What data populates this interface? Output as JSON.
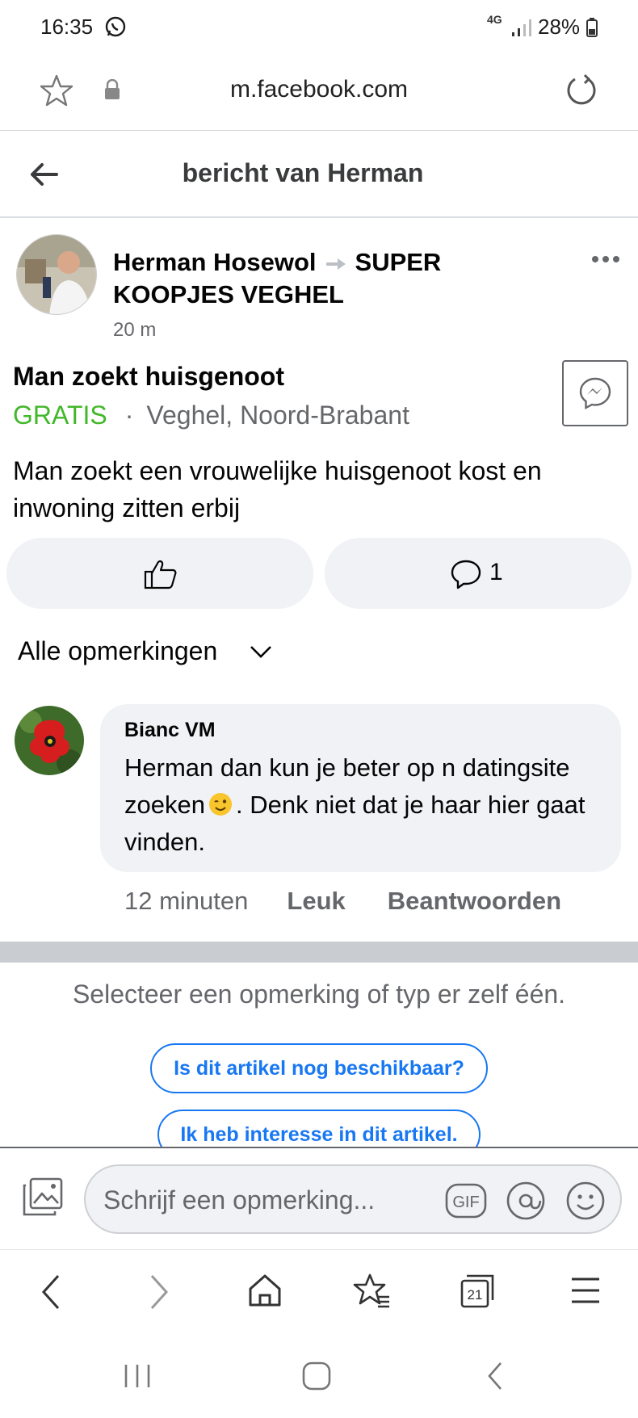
{
  "status_bar": {
    "time": "16:35",
    "network_type": "4G",
    "battery": "28%",
    "icons": [
      "whatsapp-icon",
      "signal-icon",
      "battery-icon"
    ]
  },
  "browser": {
    "url": "m.facebook.com",
    "icons": [
      "star-icon",
      "lock-icon",
      "reload-icon"
    ]
  },
  "header": {
    "title": "bericht van Herman"
  },
  "post": {
    "author": "Herman Hosewol",
    "group": "SUPER KOOPJES VEGHEL",
    "time": "20 m",
    "listing_title": "Man zoekt huisgenoot",
    "price": "GRATIS",
    "separator": "·",
    "location": "Veghel, Noord-Brabant",
    "body": "Man zoekt een vrouwelijke huisgenoot kost en inwoning zitten erbij",
    "comment_count": "1"
  },
  "comments": {
    "filter_label": "Alle opmerkingen",
    "items": [
      {
        "author": "Bianc VM",
        "text_before": "Herman dan kun je beter op n datingsite zoeken",
        "text_after": ". Denk niet dat je haar hier gaat vinden.",
        "time": "12 minuten",
        "like_label": "Leuk",
        "reply_label": "Beantwoorden"
      }
    ]
  },
  "suggestions": {
    "title": "Selecteer een opmerking of typ er zelf één.",
    "chips": [
      "Is dit artikel nog beschikbaar?",
      "Ik heb interesse in dit artikel."
    ]
  },
  "composer": {
    "placeholder": "Schrijf een opmerking...",
    "gif_label": "GIF"
  },
  "browser_nav": {
    "tabs_count": "21"
  },
  "colors": {
    "facebook_blue": "#1877f2",
    "price_green": "#42b72a",
    "secondary_text": "#65676b",
    "bubble_bg": "#f0f2f5"
  }
}
